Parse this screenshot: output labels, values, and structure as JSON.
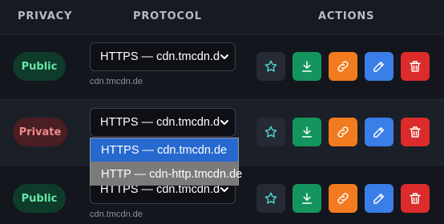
{
  "header": {
    "privacy": "PRIVACY",
    "protocol": "PROTOCOL",
    "actions": "ACTIONS"
  },
  "rows": [
    {
      "privacy": "Public",
      "protocol": "HTTPS — cdn.tmcdn.de",
      "host": "cdn.tmcdn.de"
    },
    {
      "privacy": "Private",
      "protocol": "HTTPS — cdn.tmcdn.de",
      "host": ""
    },
    {
      "privacy": "Public",
      "protocol": "HTTPS — cdn.tmcdn.de",
      "host": "cdn.tmcdn.de"
    }
  ],
  "dropdown": {
    "options": [
      "HTTPS — cdn.tmcdn.de",
      "HTTP — cdn-http.tmcdn.de"
    ],
    "highlighted": "HTTPS — cdn.tmcdn.de"
  },
  "actions": {
    "icons": [
      "star-icon",
      "download-icon",
      "link-icon",
      "edit-icon",
      "trash-icon"
    ]
  },
  "colors": {
    "favorite": "#252a34",
    "download": "#14955e",
    "link": "#f27b1f",
    "edit": "#3a7ee8",
    "delete": "#db2b2b",
    "public": "#67e6a6",
    "private": "#f08a8a"
  }
}
